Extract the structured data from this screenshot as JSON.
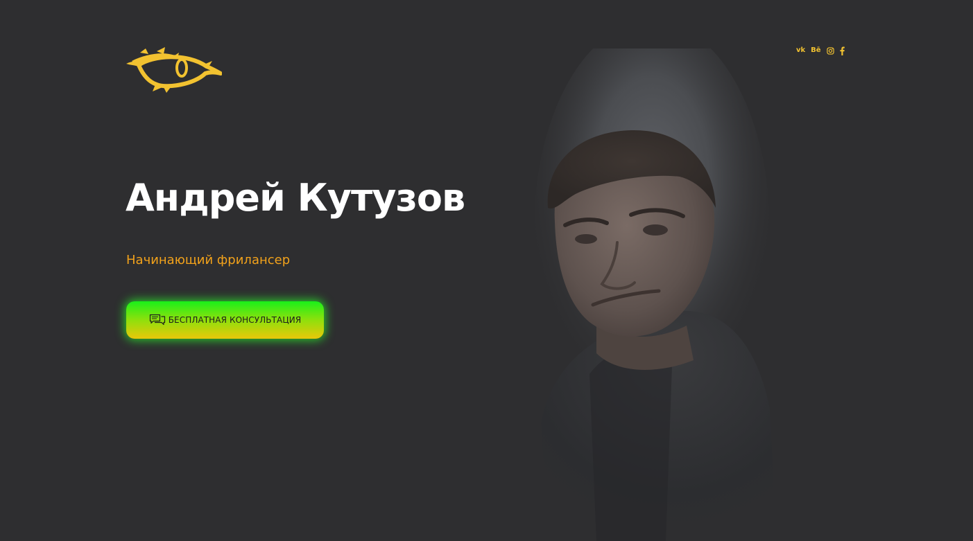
{
  "header": {
    "logo_icon": "eye-logo-icon",
    "social_links": [
      {
        "name": "vk-icon",
        "label": "vk"
      },
      {
        "name": "behance-icon",
        "label": "Bē"
      },
      {
        "name": "instagram-icon",
        "label": ""
      },
      {
        "name": "facebook-icon",
        "label": ""
      }
    ]
  },
  "hero": {
    "title": "Андрей Кутузов",
    "subtitle": "Начинающий фрилансер",
    "cta": {
      "label": "БЕСПЛАТНАЯ КОНСУЛЬТАЦИЯ",
      "icon": "chat-bubbles-icon"
    }
  },
  "colors": {
    "background": "#2e2e30",
    "accent": "#f2c230",
    "subtitle": "#f2a21b",
    "button_top": "#1af01a",
    "button_bottom": "#e9c70a"
  }
}
